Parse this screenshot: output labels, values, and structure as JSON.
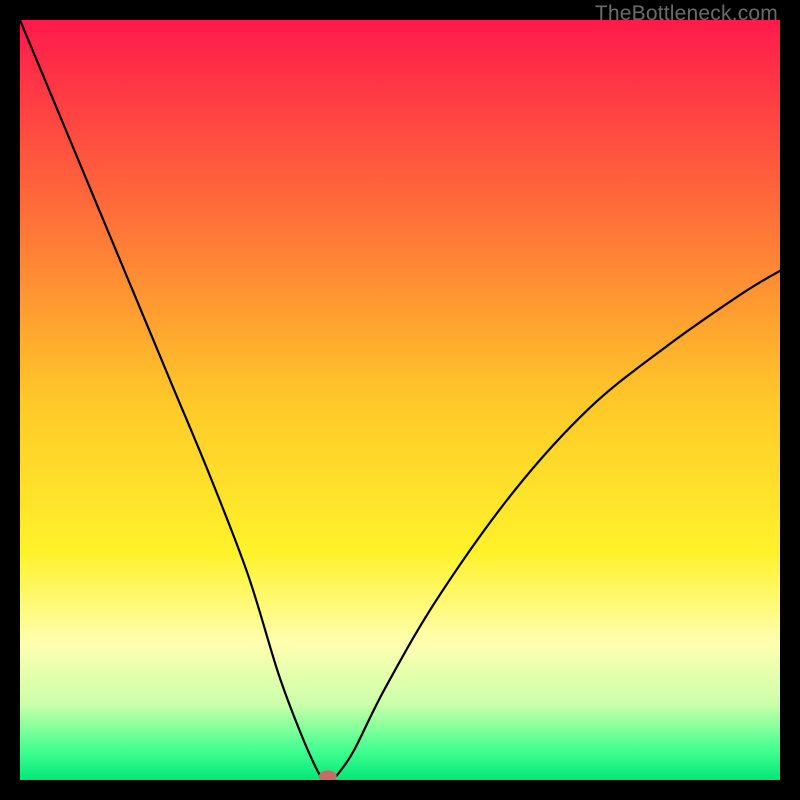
{
  "watermark": "TheBottleneck.com",
  "chart_data": {
    "type": "line",
    "title": "",
    "xlabel": "",
    "ylabel": "",
    "xlim": [
      0,
      100
    ],
    "ylim": [
      0,
      100
    ],
    "grid": false,
    "legend": false,
    "background_gradient": [
      {
        "offset": 0.0,
        "color": "#ff1a4b"
      },
      {
        "offset": 0.25,
        "color": "#ff6d39"
      },
      {
        "offset": 0.5,
        "color": "#ffc829"
      },
      {
        "offset": 0.7,
        "color": "#fff22a"
      },
      {
        "offset": 0.82,
        "color": "#ffffb0"
      },
      {
        "offset": 0.9,
        "color": "#ccffaa"
      },
      {
        "offset": 0.96,
        "color": "#44ff90"
      },
      {
        "offset": 1.0,
        "color": "#00e878"
      }
    ],
    "series": [
      {
        "name": "bottleneck-curve",
        "x": [
          0,
          5,
          10,
          15,
          20,
          25,
          30,
          34,
          37,
          39,
          40,
          41,
          42,
          44,
          48,
          55,
          65,
          75,
          85,
          95,
          100
        ],
        "y": [
          100,
          88,
          76,
          64,
          52,
          40,
          27,
          14,
          6,
          1.5,
          0,
          0,
          1,
          4,
          12,
          24,
          38,
          49,
          57,
          64,
          67
        ]
      }
    ],
    "marker": {
      "name": "optimum-marker",
      "x": 40.5,
      "y": 0,
      "color": "#c96a63",
      "rx": 9,
      "ry": 6
    }
  }
}
